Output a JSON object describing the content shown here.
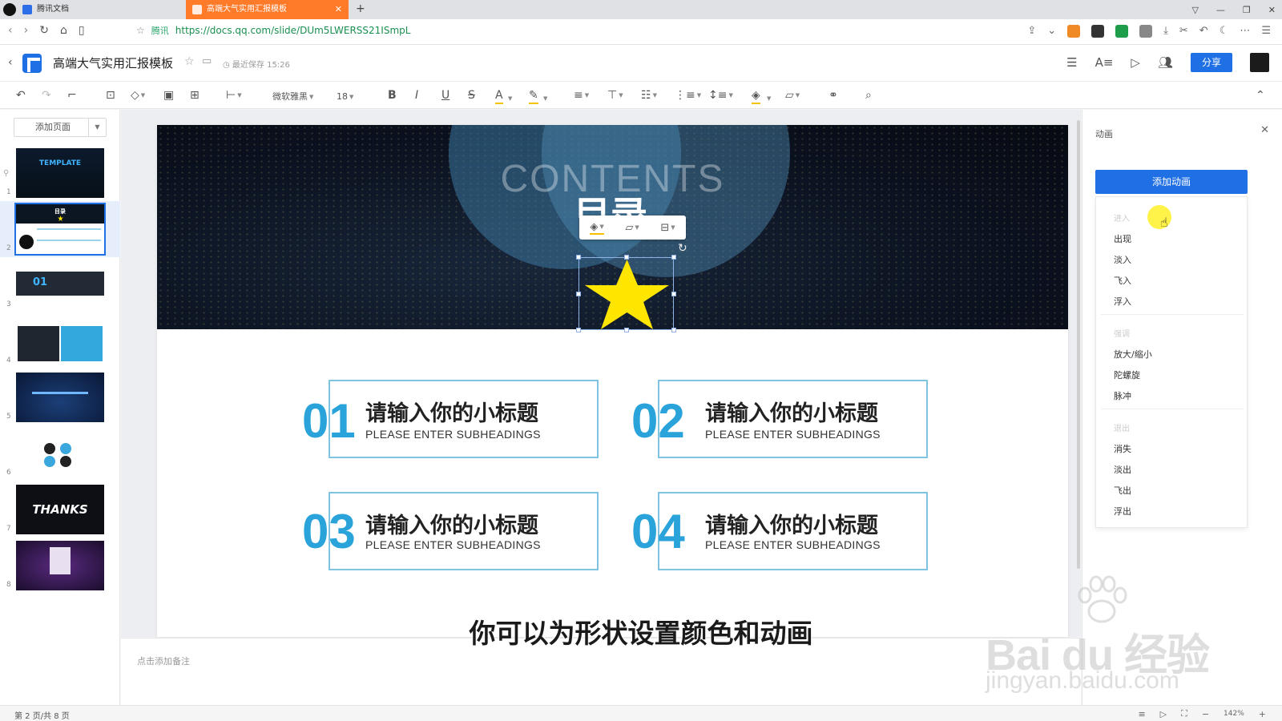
{
  "browser": {
    "tabs": [
      {
        "label": "腾讯文档"
      },
      {
        "label": "高端大气实用汇报模板"
      }
    ],
    "site_label": "腾讯",
    "url": "https://docs.qq.com/slide/DUm5LWERSS21ISmpL"
  },
  "header": {
    "doc_title": "高端大气实用汇报模板",
    "save_status": "最近保存 15:26",
    "share_label": "分享"
  },
  "toolbar": {
    "font_name": "微软雅黑",
    "font_size": "18"
  },
  "left_panel": {
    "add_page_label": "添加页面",
    "thumbs": [
      {
        "num": "1",
        "text": "TEMPLATE"
      },
      {
        "num": "2",
        "text": "目录"
      },
      {
        "num": "3",
        "text": "01"
      },
      {
        "num": "4",
        "text": ""
      },
      {
        "num": "5",
        "text": ""
      },
      {
        "num": "6",
        "text": ""
      },
      {
        "num": "7",
        "text": "THANKS"
      },
      {
        "num": "8",
        "text": ""
      }
    ]
  },
  "slide": {
    "contents_en": "CONTENTS",
    "contents_cn": "目录",
    "items": [
      {
        "num": "01",
        "title": "请输入你的小标题",
        "en": "PLEASE ENTER SUBHEADINGS"
      },
      {
        "num": "02",
        "title": "请输入你的小标题",
        "en": "PLEASE ENTER SUBHEADINGS"
      },
      {
        "num": "03",
        "title": "请输入你的小标题",
        "en": "PLEASE ENTER SUBHEADINGS"
      },
      {
        "num": "04",
        "title": "请输入你的小标题",
        "en": "PLEASE ENTER SUBHEADINGS"
      }
    ],
    "star_color": "#FFE600",
    "accent_color": "#29A3D9"
  },
  "notes_placeholder": "点击添加备注",
  "animation_panel": {
    "title": "动画",
    "add_button": "添加动画",
    "groups": [
      {
        "header": "进入",
        "items": [
          "出现",
          "淡入",
          "飞入",
          "浮入"
        ]
      },
      {
        "header": "强调",
        "items": [
          "放大/缩小",
          "陀螺旋",
          "脉冲"
        ]
      },
      {
        "header": "退出",
        "items": [
          "消失",
          "淡出",
          "飞出",
          "浮出"
        ]
      }
    ]
  },
  "status": {
    "page_info": "第 2 页/共 8 页",
    "zoom": "142%"
  },
  "caption": "你可以为形状设置颜色和动画",
  "watermark": {
    "brand": "Bai du 经验",
    "url": "jingyan.baidu.com"
  }
}
